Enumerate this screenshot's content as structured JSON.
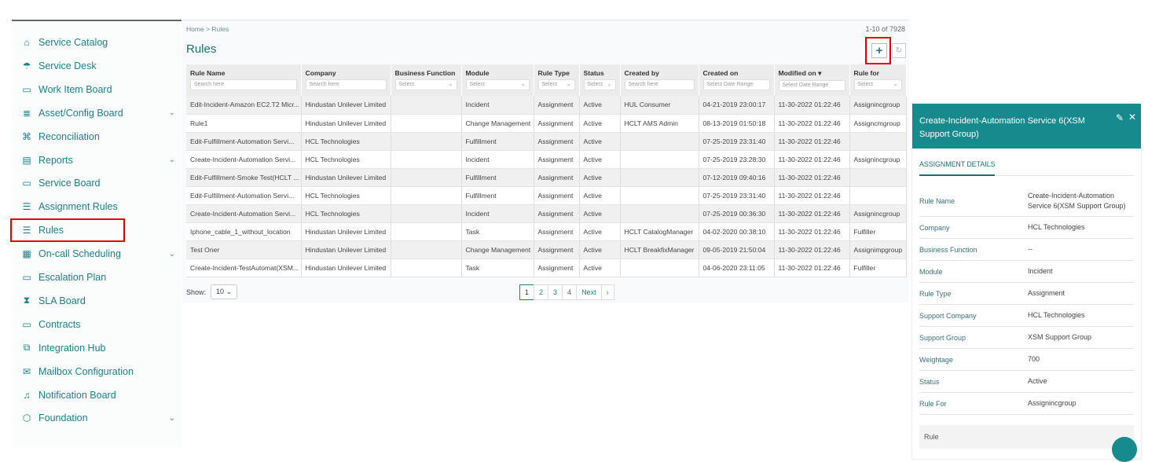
{
  "sidebar": {
    "items": [
      {
        "label": "Service Catalog",
        "icon": "bag-icon"
      },
      {
        "label": "Service Desk",
        "icon": "umbrella-icon"
      },
      {
        "label": "Work Item Board",
        "icon": "board-icon"
      },
      {
        "label": "Asset/Config Board",
        "icon": "database-icon",
        "expandable": true
      },
      {
        "label": "Reconciliation",
        "icon": "command-icon"
      },
      {
        "label": "Reports",
        "icon": "report-icon",
        "expandable": true
      },
      {
        "label": "Service Board",
        "icon": "archive-icon"
      },
      {
        "label": "Assignment Rules",
        "icon": "list-check-icon"
      },
      {
        "label": "Rules",
        "icon": "list-check-icon",
        "active": true
      },
      {
        "label": "On-call Scheduling",
        "icon": "calendar-clock-icon",
        "expandable": true
      },
      {
        "label": "Escalation Plan",
        "icon": "monitor-icon"
      },
      {
        "label": "SLA Board",
        "icon": "hourglass-icon"
      },
      {
        "label": "Contracts",
        "icon": "laptop-icon"
      },
      {
        "label": "Integration Hub",
        "icon": "copy-icon"
      },
      {
        "label": "Mailbox Configuration",
        "icon": "mail-gear-icon"
      },
      {
        "label": "Notification Board",
        "icon": "bell-icon"
      },
      {
        "label": "Foundation",
        "icon": "cube-icon",
        "expandable": true
      }
    ]
  },
  "main": {
    "breadcrumb": {
      "home": "Home",
      "sep": ">",
      "current": "Rules"
    },
    "title": "Rules",
    "record_count": "1-10 of 7928",
    "add_label": "+",
    "columns": [
      {
        "label": "Rule Name",
        "filter": "Search here"
      },
      {
        "label": "Company",
        "filter": "Search here"
      },
      {
        "label": "Business Function",
        "filter": "Select"
      },
      {
        "label": "Module",
        "filter": "Select"
      },
      {
        "label": "Rule Type",
        "filter": "Select"
      },
      {
        "label": "Status",
        "filter": "Select"
      },
      {
        "label": "Created by",
        "filter": "Search here"
      },
      {
        "label": "Created on",
        "filter": "Select Date Range"
      },
      {
        "label": "Modified on",
        "filter": "Select Date Range",
        "sort": "▾"
      },
      {
        "label": "Rule for",
        "filter": "Select"
      }
    ],
    "rows": [
      [
        "Edit-Incident-Amazon EC2.T2 Micr...",
        "Hindustan Unilever Limited",
        "",
        "Incident",
        "Assignment",
        "Active",
        "HUL Consumer",
        "04-21-2019 23:00:17",
        "11-30-2022 01:22:46",
        "Assignincgroup"
      ],
      [
        "Rule1",
        "Hindustan Unilever Limited",
        "",
        "Change Management",
        "Assignment",
        "Active",
        "HCLT AMS Admin",
        "08-13-2019 01:50:18",
        "11-30-2022 01:22:46",
        "Assigncmgroup"
      ],
      [
        "Edit-Fulfillment-Automation Servi...",
        "HCL Technologies",
        "",
        "Fulfillment",
        "Assignment",
        "Active",
        "",
        "07-25-2019 23:31:40",
        "11-30-2022 01:22:46",
        ""
      ],
      [
        "Create-Incident-Automation Servi...",
        "HCL Technologies",
        "",
        "Incident",
        "Assignment",
        "Active",
        "",
        "07-25-2019 23:28:30",
        "11-30-2022 01:22:46",
        "Assignincgroup"
      ],
      [
        "Edit-Fulfillment-Smoke Test(HCLT ...",
        "Hindustan Unilever Limited",
        "",
        "Fulfillment",
        "Assignment",
        "Active",
        "",
        "07-12-2019 09:40:16",
        "11-30-2022 01:22:46",
        ""
      ],
      [
        "Edit-Fulfillment-Automation Servi...",
        "HCL Technologies",
        "",
        "Fulfillment",
        "Assignment",
        "Active",
        "",
        "07-25-2019 23:31:40",
        "11-30-2022 01:22:46",
        ""
      ],
      [
        "Create-Incident-Automation Servi...",
        "HCL Technologies",
        "",
        "Incident",
        "Assignment",
        "Active",
        "",
        "07-25-2019 00:36:30",
        "11-30-2022 01:22:46",
        "Assignincgroup"
      ],
      [
        "Iphone_cable_1_without_location",
        "Hindustan Unilever Limited",
        "",
        "Task",
        "Assignment",
        "Active",
        "HCLT CatalogManager",
        "04-02-2020 00:38:10",
        "11-30-2022 01:22:46",
        "Fulfiller"
      ],
      [
        "Test Oner",
        "Hindustan Unilever Limited",
        "",
        "Change Management",
        "Assignment",
        "Active",
        "HCLT BreakfixManager",
        "09-05-2019 21:50:04",
        "11-30-2022 01:22:46",
        "Assignimpgroup"
      ],
      [
        "Create-Incident-TestAutomat(XSM...",
        "Hindustan Unilever Limited",
        "",
        "Task",
        "Assignment",
        "Active",
        "",
        "04-06-2020 23:11:05",
        "11-30-2022 01:22:46",
        "Fulfiller"
      ]
    ],
    "show_label": "Show:",
    "page_size": "10",
    "pages": [
      "1",
      "2",
      "3",
      "4"
    ],
    "next_label": "Next",
    "next_arrow": "›"
  },
  "panel": {
    "title": "Create-Incident-Automation Service 6(XSM Support Group)",
    "tab": "ASSIGNMENT DETAILS",
    "fields": [
      {
        "k": "Rule Name",
        "v": "Create-Incident-Automation Service 6(XSM Support Group)"
      },
      {
        "k": "Company",
        "v": "HCL Technologies"
      },
      {
        "k": "Business Function",
        "v": "--"
      },
      {
        "k": "Module",
        "v": "Incident"
      },
      {
        "k": "Rule Type",
        "v": "Assignment"
      },
      {
        "k": "Support Company",
        "v": "HCL Technologies"
      },
      {
        "k": "Support Group",
        "v": "XSM Support Group"
      },
      {
        "k": "Weightage",
        "v": "700"
      },
      {
        "k": "Status",
        "v": "Active"
      },
      {
        "k": "Rule For",
        "v": "Assignincgroup"
      }
    ],
    "rule_section": "Rule"
  },
  "colors": {
    "accent": "#178a8d",
    "nav_text": "#1d7f87",
    "highlight": "#e60000"
  }
}
